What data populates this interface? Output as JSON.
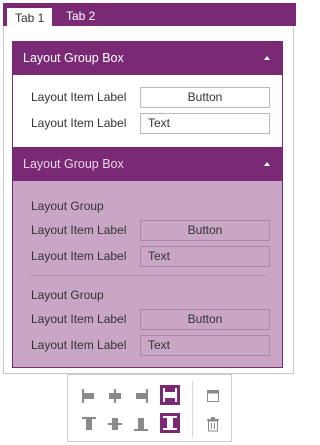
{
  "tabs": [
    {
      "label": "Tab 1",
      "selected": true
    },
    {
      "label": "Tab 2",
      "selected": false
    }
  ],
  "group_box_1": {
    "title": "Layout Group Box",
    "rows": [
      {
        "label": "Layout Item Label",
        "control": "Button"
      },
      {
        "label": "Layout Item Label",
        "control": "Text"
      }
    ]
  },
  "group_box_2": {
    "title": "Layout Group Box",
    "groups": [
      {
        "title": "Layout Group",
        "rows": [
          {
            "label": "Layout Item Label",
            "control": "Button"
          },
          {
            "label": "Layout Item Label",
            "control": "Text"
          }
        ]
      },
      {
        "title": "Layout Group",
        "rows": [
          {
            "label": "Layout Item Label",
            "control": "Button"
          },
          {
            "label": "Layout Item Label",
            "control": "Text"
          }
        ]
      }
    ]
  },
  "toolbar": {
    "icons": [
      "align-left-icon",
      "align-center-horizontal-icon",
      "align-right-icon",
      "stretch-horizontal-icon",
      "align-top-icon",
      "align-center-vertical-icon",
      "align-bottom-icon",
      "stretch-vertical-icon",
      "group-box-icon",
      "delete-icon"
    ]
  },
  "colors": {
    "accent": "#7a2a74",
    "selected_group_bg": "#c9a6c6",
    "icon_gray": "#8a8a8a"
  }
}
